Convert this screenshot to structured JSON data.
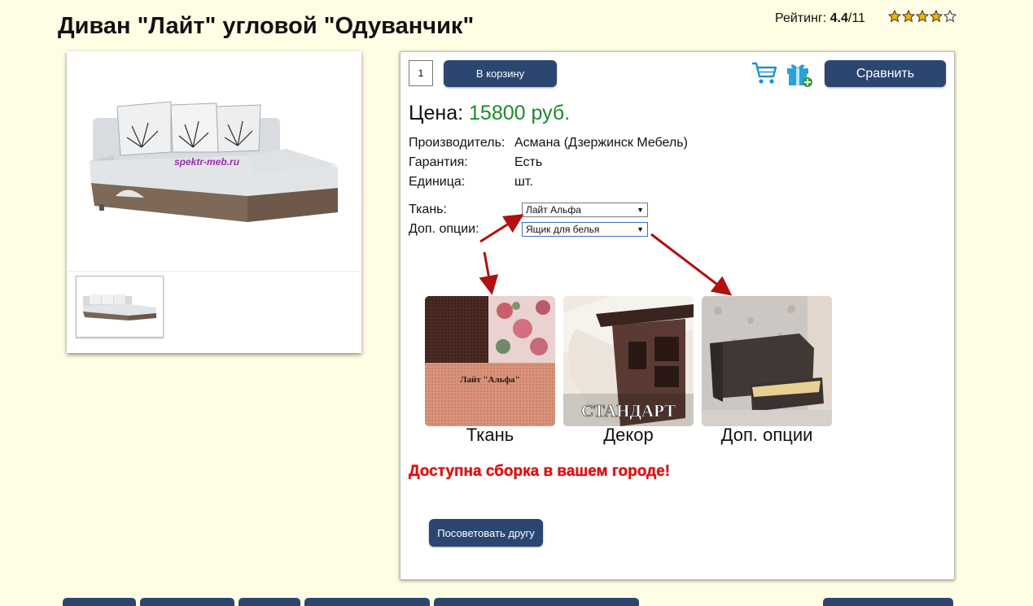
{
  "product": {
    "title": "Диван \"Лайт\" угловой \"Одуванчик\"",
    "rating_label": "Рейтинг:",
    "rating_value": "4.4",
    "rating_max": "/11",
    "stars_filled": 4,
    "stars_total": 5,
    "photo_watermark": "spektr-meb.ru"
  },
  "order": {
    "quantity": "1",
    "cart_button": "В корзину",
    "compare_button": "Сравнить"
  },
  "price": {
    "label": "Цена:",
    "value": "15800 руб."
  },
  "specs": [
    {
      "label": "Производитель:",
      "value": "Асмана (Дзержинск Мебель)"
    },
    {
      "label": "Гарантия:",
      "value": "Есть"
    },
    {
      "label": "Единица:",
      "value": "шт."
    }
  ],
  "options": [
    {
      "label": "Ткань:",
      "selected": "Лайт Альфа"
    },
    {
      "label": "Доп. опции:",
      "selected": "Ящик для белья"
    }
  ],
  "swatches": [
    {
      "caption": "Ткань",
      "overlay": "Лайт \"Альфа\""
    },
    {
      "caption": "Декор",
      "overlay": "СТАНДАРТ"
    },
    {
      "caption": "Доп. опции",
      "overlay": ""
    }
  ],
  "assembly_notice": "Доступна сборка в вашем городе!",
  "advise_button": "Посоветовать другу",
  "colors": {
    "background": "#fffde3",
    "button": "#2b4670",
    "price": "#1d8a2b",
    "notice": "#e01010",
    "arrows": "#b01010"
  }
}
